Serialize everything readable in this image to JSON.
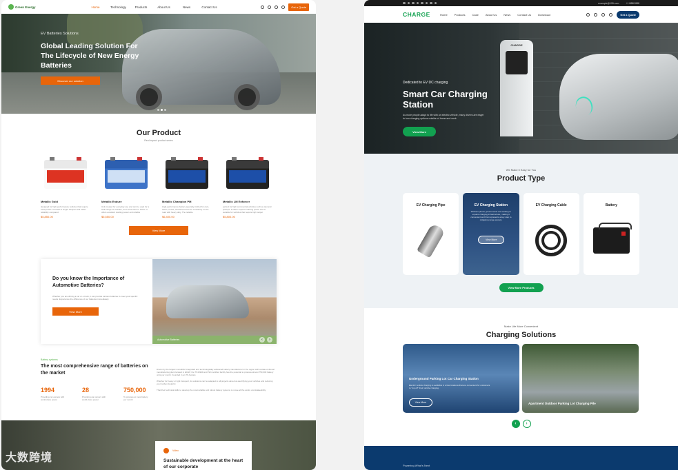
{
  "left": {
    "logo": "Green Energy",
    "nav": [
      "Home",
      "Technology",
      "Products",
      "About Us",
      "News",
      "Contact Us"
    ],
    "quote_button": "Get a Quote",
    "hero": {
      "kicker": "EV Batteries Solutions",
      "title": "Global Leading Solution For The Lifecycle of New Energy Batteries",
      "button": "Discover our solution"
    },
    "products_section": {
      "title": "Our Product",
      "subtitle": "Real impact product series",
      "items": [
        {
          "name": "Metallic Gold",
          "desc": "designed for high-performance vehicles that require extra power. It boasts a longer lifespan and better reliability compared",
          "price": "$5,850.00"
        },
        {
          "name": "Metallic Endure",
          "desc": "Unit created for everyday use and can be used for a wide range of vehicles, from small cars to SUVs. It offers excellent starting power and reliable",
          "price": "$5,550.00"
        },
        {
          "name": "Metallic Champion PM",
          "desc": "High-performance battery specially crafted for cars, SUVs, trucks, and buses that are constantly on the road with heavy duty. The reliable",
          "price": "$6,400.00"
        },
        {
          "name": "Metallic LM Enforcer",
          "desc": "perfect for high commercial vehicles such as taxi and pickups. It offers superior starting power and is suitable for vehicles that require high output",
          "price": "$5,800.00"
        }
      ],
      "view_more": "View More"
    },
    "info": {
      "title": "Do you know the Importance of Automotive Batteries?",
      "text": "Whether you are driving a car or a truck, it can provide various batteries to meet your specific needs. Experience the difference of our batteries immediately.",
      "button": "View More",
      "caption": "Automotive Batteries",
      "prev": "‹",
      "next": "›"
    },
    "stats": {
      "tag": "Battery systems",
      "title": "The most comprehensive range of batteries on the market",
      "items": [
        {
          "value": "1994",
          "label": "Providing car owners with world-class power"
        },
        {
          "value": "28",
          "label": "Providing car owners with world-class power"
        },
        {
          "value": "750,000",
          "label": "To produce at most battery per month"
        }
      ],
      "paragraphs": [
        "Driven by the largest monolithic integrated and technologically advanced battery manufacturer in the region with a state-of-the-art manufacturing plant located in ECHP, the TS16949 and ISO-certified facility has the potential to produce almost 750,000 battery units per month. Founded in an 76-hectare",
        "Whether for heavy or light transport, its solutions can be adapted to all projects aimed at electrifying your vehicles and reducing your carbon footprint",
        "That their technical skills to develop the most reliable and robust battery systems to move all the works unmistakeability."
      ]
    },
    "footer_box": {
      "label": "Video",
      "title": "Sustainable development at the heart of our corporate"
    },
    "watermark": "大数跨境"
  },
  "right": {
    "topbar": {
      "email": "example@126.com",
      "phone": "+1 8888 888"
    },
    "logo": "CHARGE",
    "nav": [
      "Home",
      "Products",
      "Case",
      "About Us",
      "News",
      "Contact Us",
      "Download"
    ],
    "quote_button": "Get a Quote",
    "hero": {
      "kicker": "Dedicated to EV DC charging",
      "title": "Smart Car Charging Station",
      "text": "As more people adapt to life with an electric vehicle, many drivers are eager to turn charging options outside of home and work.",
      "button": "View More",
      "station_label": "CHARGE"
    },
    "product_type": {
      "kicker": "We Make it Easy for You",
      "title": "Product Type",
      "cards": [
        {
          "title": "EV Charging Pipe"
        },
        {
          "title": "EV Charging Station",
          "desc": "Workers phone governments are working to expand charging infrastructure, making it convenient and that represents a key step to mitigating range anxiety.",
          "button": "View More"
        },
        {
          "title": "EV Charging Cable"
        },
        {
          "title": "Battery"
        }
      ],
      "button": "View More Products"
    },
    "solutions": {
      "kicker": "Make Life More Convenient",
      "title": "Charging Solutions",
      "cards": [
        {
          "title": "Underground Parking Lot Car Charging Station",
          "desc": "Electric vehicle charging is available in a few locations that are convenient for customers to \"top off\" their vehicle charging.",
          "button": "View More"
        },
        {
          "title": "Apartment Outdoor Parking Lot Charging Pile"
        }
      ],
      "prev": "‹",
      "next": "›"
    },
    "bottom_text": "Powering What's Next"
  }
}
